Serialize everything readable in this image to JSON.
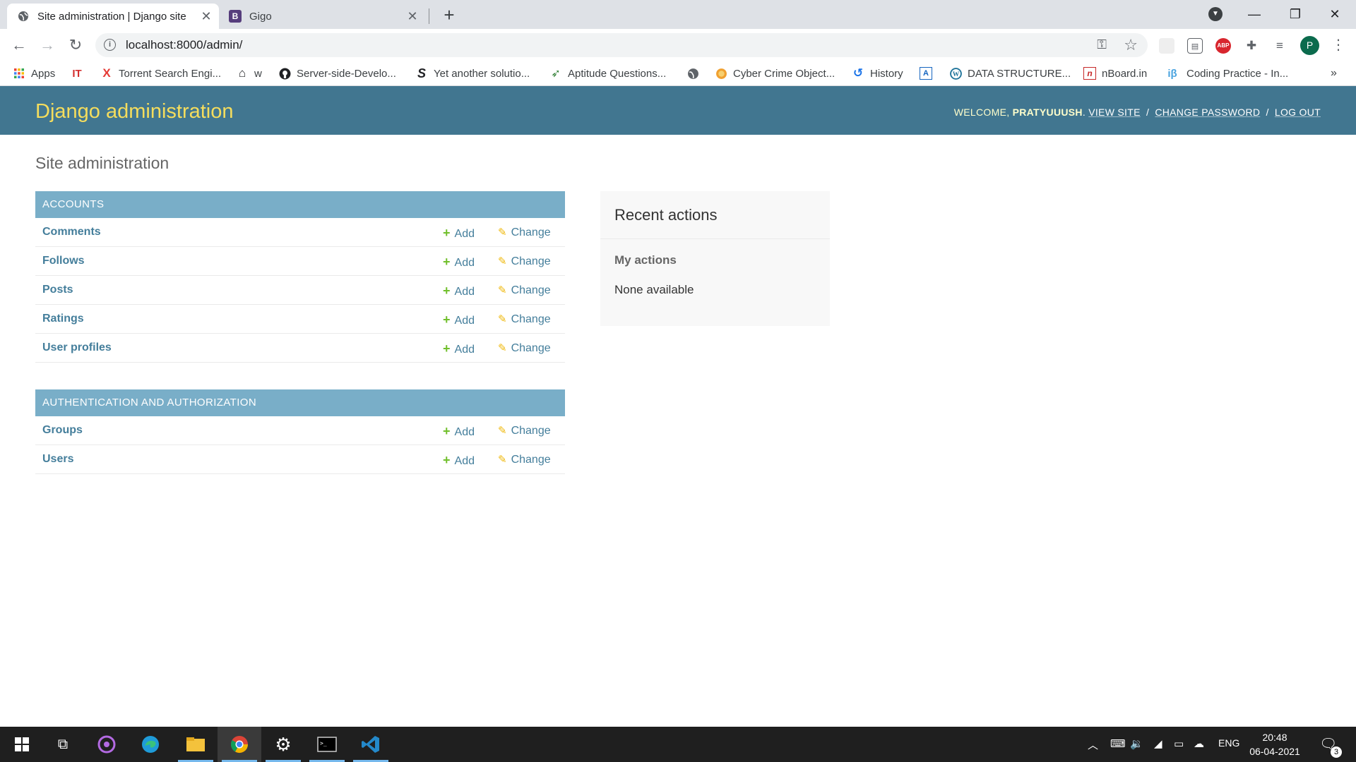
{
  "browser": {
    "tabs": [
      {
        "title": "Site administration | Django site",
        "active": true
      },
      {
        "title": "Gigo",
        "active": false,
        "favicon_letter": "B"
      }
    ],
    "url": "localhost:8000/admin/",
    "profile_initial": "P",
    "bookmarks": [
      {
        "label": "Apps",
        "icon": "apps-grid-icon"
      },
      {
        "label": "",
        "icon": "it-icon",
        "glyph": "IT"
      },
      {
        "label": "Torrent Search Engi...",
        "icon": "x-icon",
        "glyph": "X"
      },
      {
        "label": "w",
        "icon": "home-icon"
      },
      {
        "label": "Server-side-Develo...",
        "icon": "github-icon"
      },
      {
        "label": "Yet another solutio...",
        "icon": "s-icon",
        "glyph": "S"
      },
      {
        "label": "Aptitude Questions...",
        "icon": "aptitude-icon"
      },
      {
        "label": "",
        "icon": "globe-icon"
      },
      {
        "label": "Cyber Crime Object...",
        "icon": "cyber-icon"
      },
      {
        "label": "History",
        "icon": "history-icon"
      },
      {
        "label": "",
        "icon": "leetcode-icon"
      },
      {
        "label": "DATA STRUCTURE...",
        "icon": "wordpress-icon"
      },
      {
        "label": "nBoard.in",
        "icon": "nboard-icon",
        "glyph": "n"
      },
      {
        "label": "Coding Practice - In...",
        "icon": "interviewbit-icon",
        "glyph": "iβ"
      }
    ]
  },
  "admin": {
    "branding": "Django administration",
    "welcome": "WELCOME,",
    "username": "PRATYUUUSH",
    "view_site": "VIEW SITE",
    "change_password": "CHANGE PASSWORD",
    "log_out": "LOG OUT",
    "page_title": "Site administration",
    "add_label": "Add",
    "change_label": "Change",
    "modules": [
      {
        "caption": "ACCOUNTS",
        "models": [
          "Comments",
          "Follows",
          "Posts",
          "Ratings",
          "User profiles"
        ]
      },
      {
        "caption": "AUTHENTICATION AND AUTHORIZATION",
        "models": [
          "Groups",
          "Users"
        ]
      }
    ],
    "recent": {
      "title": "Recent actions",
      "subtitle": "My actions",
      "empty": "None available"
    }
  },
  "taskbar": {
    "language": "ENG",
    "time": "20:48",
    "date": "06-04-2021",
    "notification_count": "3"
  },
  "colors": {
    "header_bg": "#417690",
    "branding": "#f5dd5d",
    "module_caption": "#79aec8",
    "link": "#447e9b",
    "add_icon": "#70bf2b",
    "change_icon": "#efb80b"
  }
}
